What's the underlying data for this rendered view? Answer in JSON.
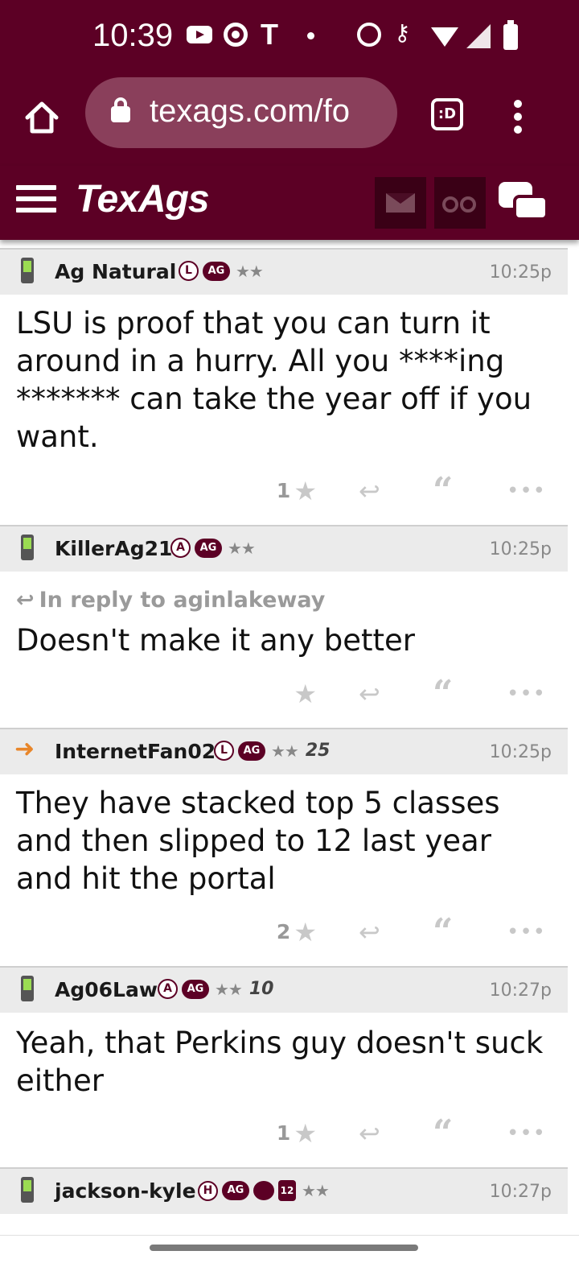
{
  "status_bar": {
    "time": "10:39",
    "icon_t": "T"
  },
  "browser": {
    "url": "texags.com/fo",
    "tab_button": ":D"
  },
  "site": {
    "logo": "TexAgs"
  },
  "posts": [
    {
      "username": "Ag Natural",
      "badges": {
        "letter": "L",
        "ag": "AG",
        "stars": "★★",
        "rank": ""
      },
      "time": "10:25p",
      "reply_to": "",
      "body": "LSU is proof that you can turn it around in a hurry. All you ****ing ******* can take the year off if you want.",
      "star_count": "1"
    },
    {
      "username": "KillerAg21",
      "badges": {
        "letter": "A",
        "ag": "AG",
        "stars": "★★",
        "rank": ""
      },
      "time": "10:25p",
      "reply_to": "In reply to aginlakeway",
      "body": "Doesn't make it any better",
      "star_count": ""
    },
    {
      "username": "InternetFan02",
      "badges": {
        "letter": "L",
        "ag": "AG",
        "stars": "★★",
        "rank": "25"
      },
      "time": "10:25p",
      "reply_to": "",
      "body": "They have stacked top 5 classes and then slipped to 12 last year and hit the portal",
      "star_count": "2"
    },
    {
      "username": "Ag06Law",
      "badges": {
        "letter": "A",
        "ag": "AG",
        "stars": "★★",
        "rank": "10"
      },
      "time": "10:27p",
      "reply_to": "",
      "body": "Yeah, that Perkins guy doesn't suck either",
      "star_count": "1"
    },
    {
      "username": "jackson-kyle",
      "badges": {
        "letter": "H",
        "ag": "AG",
        "stars": "★★",
        "rank": "",
        "twelve": "12"
      },
      "time": "10:27p",
      "reply_to": "",
      "body": "",
      "star_count": ""
    }
  ]
}
